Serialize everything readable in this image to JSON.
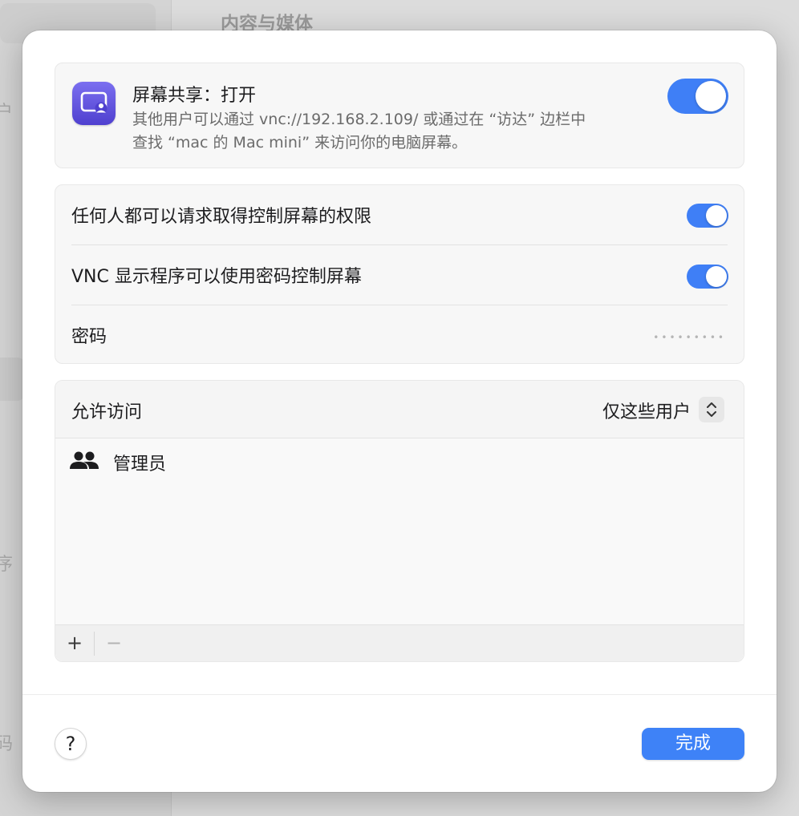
{
  "background": {
    "title": "内容与媒体",
    "side_chars": [
      "户",
      "序",
      "码"
    ]
  },
  "share_card": {
    "title": "屏幕共享：打开",
    "description_line1": "其他用户可以通过 vnc://192.168.2.109/ 或通过在 “访达” 边栏中",
    "description_line2": "查找 “mac 的 Mac mini” 来访问你的电脑屏幕。",
    "enabled": true
  },
  "settings": {
    "anyone_request": {
      "label": "任何人都可以请求取得控制屏幕的权限",
      "enabled": true
    },
    "vnc_password": {
      "label": "VNC 显示程序可以使用密码控制屏幕",
      "enabled": true
    },
    "password": {
      "label": "密码",
      "value": "•••••••••"
    }
  },
  "access": {
    "label": "允许访问",
    "selected": "仅这些用户",
    "users": [
      {
        "name": "管理员",
        "icon": "group-icon"
      }
    ],
    "add": "+",
    "remove": "−"
  },
  "footer": {
    "help": "?",
    "done": "完成"
  },
  "colors": {
    "accent": "#3f7ff6",
    "icon_top": "#7b6ff0",
    "icon_bottom": "#4f40cf"
  }
}
